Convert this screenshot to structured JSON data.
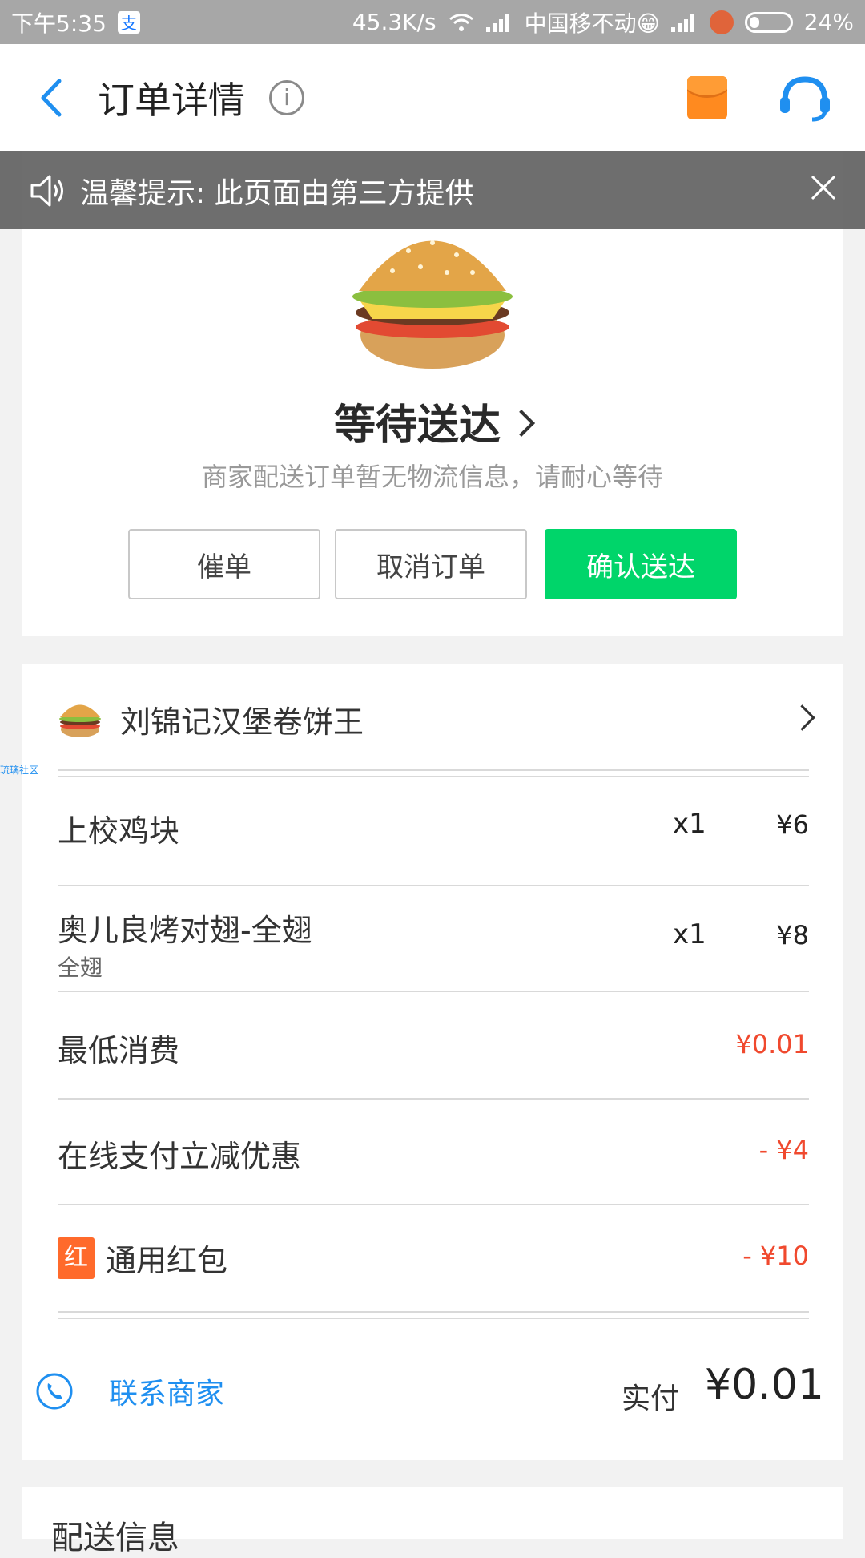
{
  "status_bar": {
    "time": "下午5:35",
    "app_badge": "支",
    "net_speed": "45.3K/s",
    "carrier": "中国移不动😁",
    "battery": "24%"
  },
  "header": {
    "title": "订单详情",
    "info_glyph": "i"
  },
  "banner": {
    "text": "温馨提示: 此页面由第三方提供"
  },
  "order_status": {
    "title": "等待送达",
    "subtitle": "商家配送订单暂无物流信息，请耐心等待",
    "buttons": {
      "urge": "催单",
      "cancel": "取消订单",
      "confirm": "确认送达"
    }
  },
  "shop": {
    "name": "刘锦记汉堡卷饼王"
  },
  "items": [
    {
      "name": "上校鸡块",
      "qty": "x1",
      "price": "¥6"
    },
    {
      "name": "奥儿良烤对翅-全翅",
      "spec": "全翅",
      "qty": "x1",
      "price": "¥8"
    }
  ],
  "fees": {
    "min_label": "最低消费",
    "min_value": "¥0.01",
    "online_label": "在线支付立减优惠",
    "online_value": "- ¥4",
    "hongbao_badge": "红",
    "hongbao_label": "通用红包",
    "hongbao_value": "- ¥10"
  },
  "footer": {
    "contact": "联系商家",
    "paid_label": "实付",
    "paid_amount": "¥0.01"
  },
  "delivery": {
    "title": "配送信息"
  },
  "watermark": "琉璃社区",
  "colors": {
    "accent_green": "#00d56a",
    "link_blue": "#1f8ff0",
    "discount_red": "#f0492e"
  }
}
